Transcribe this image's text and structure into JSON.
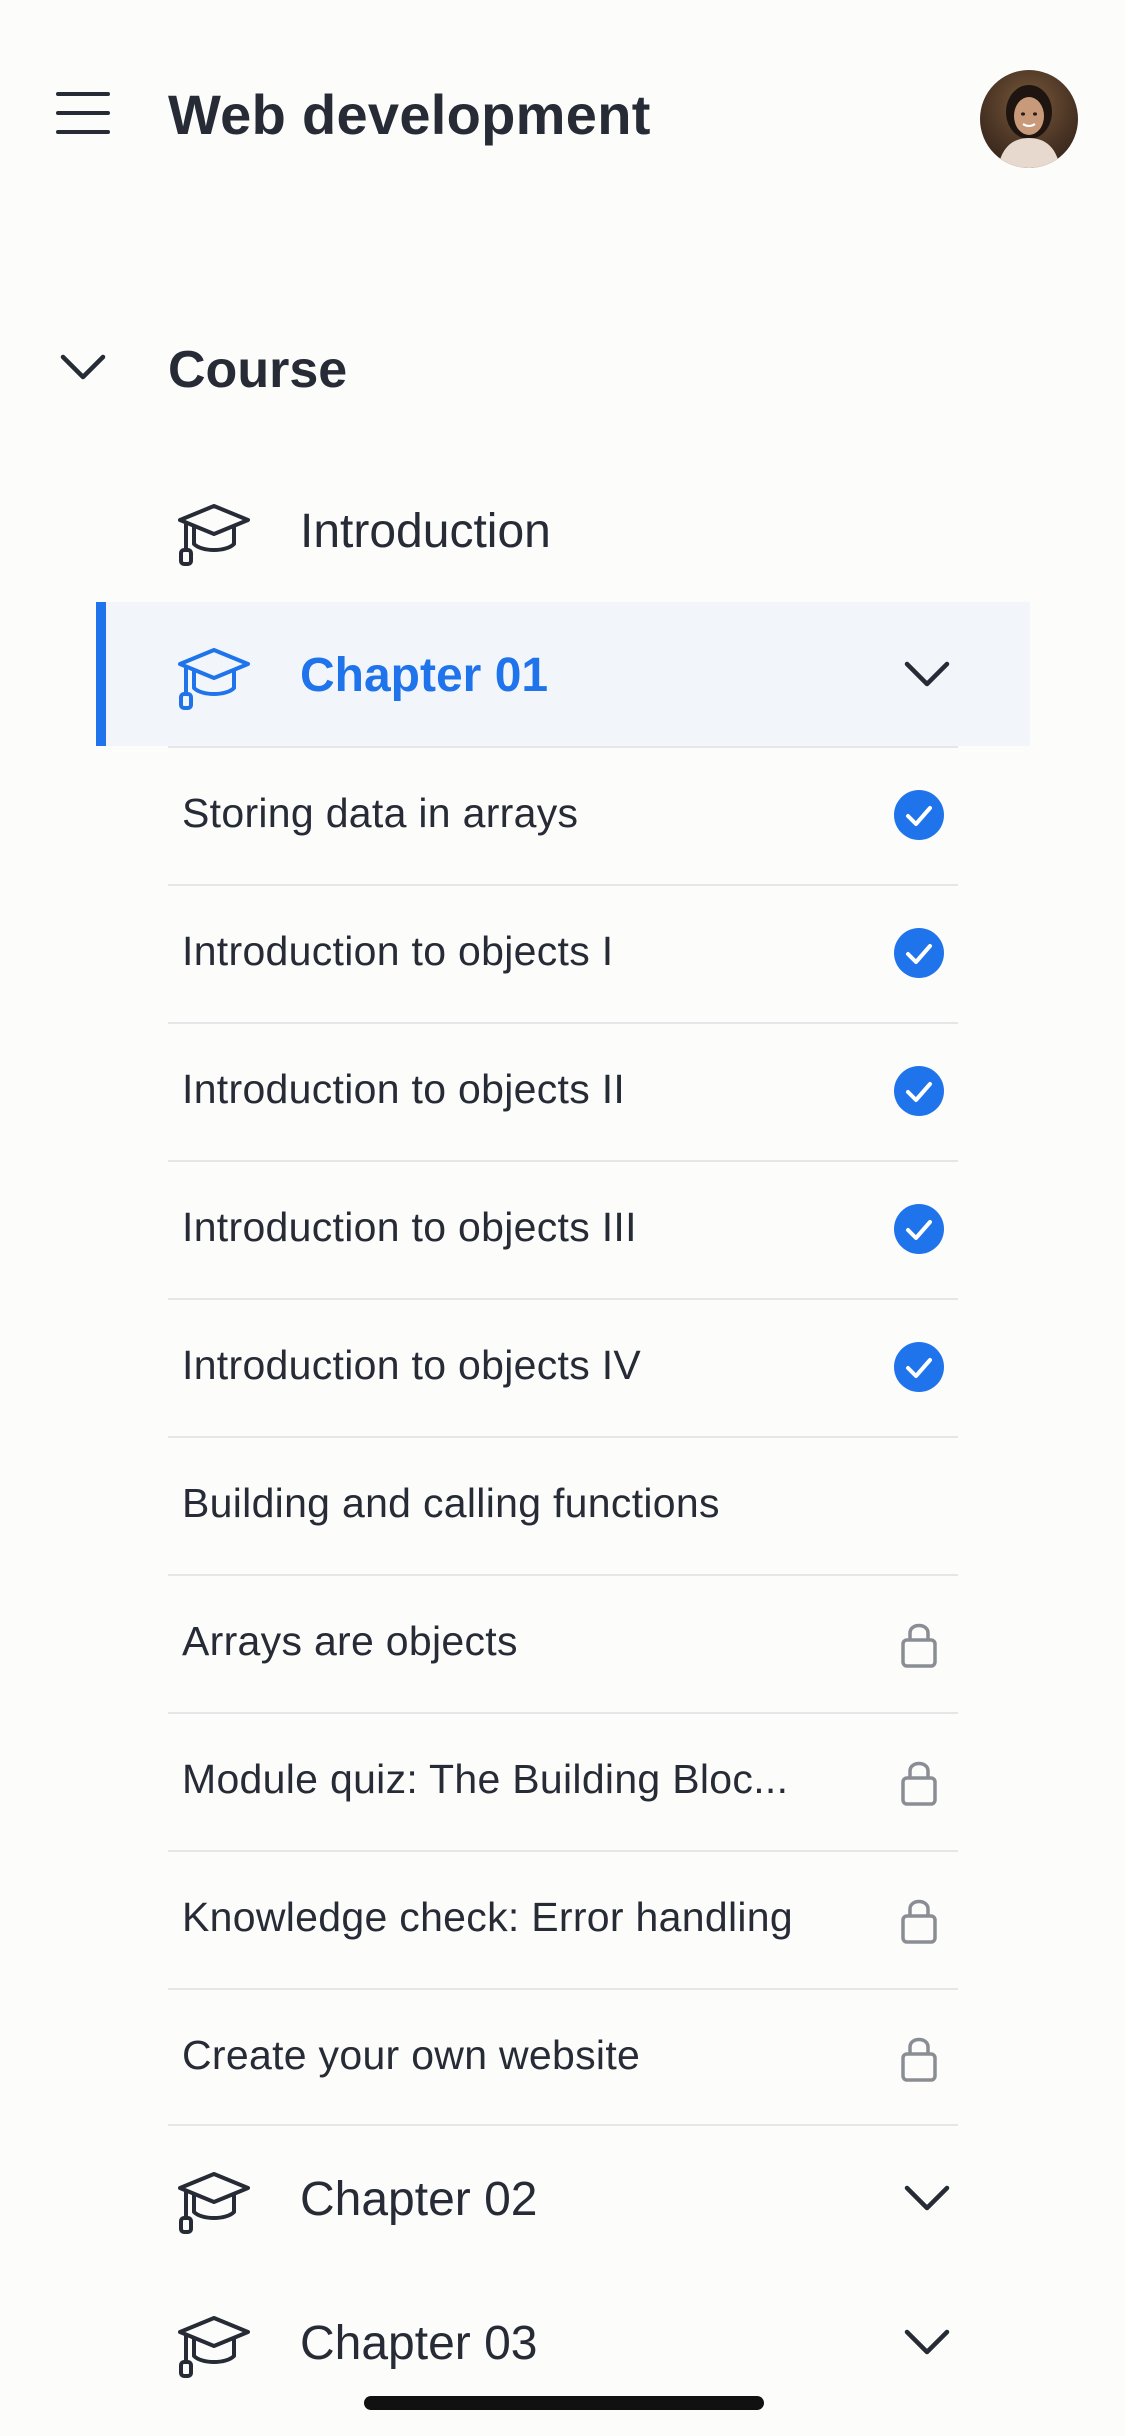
{
  "header": {
    "title": "Web development",
    "menu_icon": "hamburger-menu-icon",
    "avatar_icon": "user-avatar"
  },
  "course": {
    "label": "Course",
    "expanded": true
  },
  "nav": {
    "introduction": {
      "label": "Introduction",
      "icon": "graduation-cap-icon"
    },
    "chapter01": {
      "label": "Chapter 01",
      "icon": "graduation-cap-icon",
      "active": true
    },
    "chapter02": {
      "label": "Chapter 02",
      "icon": "graduation-cap-icon"
    },
    "chapter03": {
      "label": "Chapter 03",
      "icon": "graduation-cap-icon"
    }
  },
  "lessons": [
    {
      "title": "Storing data in arrays",
      "status": "completed"
    },
    {
      "title": "Introduction to objects I",
      "status": "completed"
    },
    {
      "title": "Introduction to objects II",
      "status": "completed"
    },
    {
      "title": "Introduction to objects III",
      "status": "completed"
    },
    {
      "title": "Introduction to objects IV",
      "status": "completed"
    },
    {
      "title": "Building and calling functions",
      "status": "available"
    },
    {
      "title": "Arrays are objects",
      "status": "locked"
    },
    {
      "title": "Module quiz: The Building Bloc...",
      "status": "locked"
    },
    {
      "title": "Knowledge check: Error handling",
      "status": "locked"
    },
    {
      "title": "Create your own website",
      "status": "locked"
    }
  ],
  "colors": {
    "accent": "#1F74EC",
    "text": "#262B36",
    "background": "#FCFCFB",
    "active_row": "#F2F6FB",
    "lock": "#8A8D93"
  }
}
